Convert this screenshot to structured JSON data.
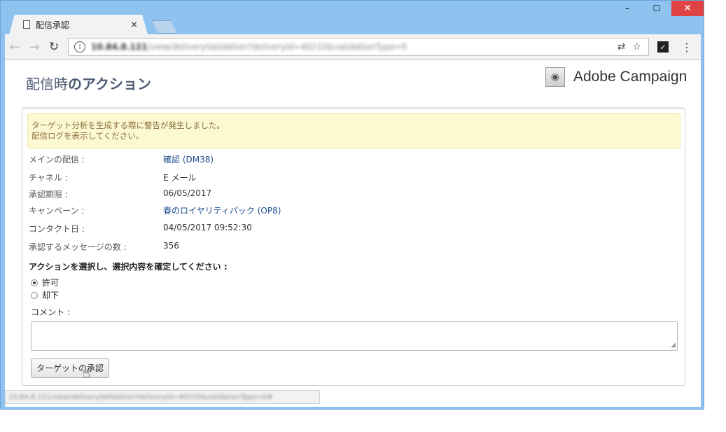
{
  "browser": {
    "tab_title": "配信承認",
    "tab_close": "×",
    "url_host": "10.84.8.121",
    "url_path": "/view/deliveryValidation?deliveryId=40210&validationType=0",
    "status_url": "10.84.8.121/view/deliveryValidation?deliveryId=40210&validationType=0#",
    "win_minimize": "–",
    "win_maximize": "☐",
    "win_close": "✕"
  },
  "header": {
    "title_part1": "配信時",
    "title_part2": "のアクション",
    "brand": "Adobe Campaign"
  },
  "warning": {
    "line1": "ターゲット分析を生成する際に警告が発生しました。",
    "line2": "配信ログを表示してください。"
  },
  "details": [
    {
      "label": "メインの配信 :",
      "value": "確認 (DM38)"
    },
    {
      "label": "チャネル :",
      "value": "E メール"
    },
    {
      "label": "承認期限 :",
      "value": "06/05/2017"
    },
    {
      "label": "キャンペーン :",
      "value": "春のロイヤリティパック (OP8)"
    },
    {
      "label": "コンタクト日 :",
      "value": "04/05/2017 09:52:30"
    },
    {
      "label": "承認するメッセージの数 :",
      "value": "356"
    }
  ],
  "action": {
    "prompt": "アクションを選択し、選択内容を確定してください :",
    "options": [
      "許可",
      "却下"
    ],
    "selected": "許可",
    "comment_label": "コメント :",
    "comment_value": "",
    "approve_button": "ターゲットの承認"
  }
}
